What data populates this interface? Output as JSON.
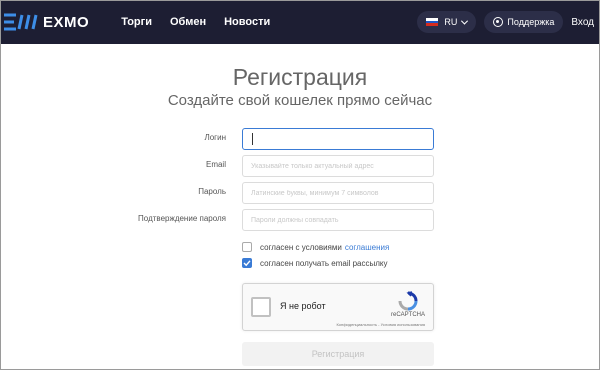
{
  "nav": {
    "brand": "EXMO",
    "menu": [
      "Торги",
      "Обмен",
      "Новости"
    ],
    "language": "RU",
    "support_label": "Поддержка",
    "login_label": "Вход"
  },
  "form": {
    "title": "Регистрация",
    "subtitle": "Создайте свой кошелек прямо сейчас",
    "fields": [
      {
        "label": "Логин",
        "value": "",
        "placeholder": ""
      },
      {
        "label": "Email",
        "value": "",
        "placeholder": "Указывайте только актуальный адрес"
      },
      {
        "label": "Пароль",
        "value": "",
        "placeholder": "Латинские буквы, минимум 7 символов"
      },
      {
        "label": "Подтверждение пароля",
        "value": "",
        "placeholder": "Пароли должны совпадать"
      }
    ],
    "agree_text": "согласен с условиями",
    "agree_link": "соглашения",
    "agree_checked": false,
    "newsletter_text": "согласен получать email рассылку",
    "newsletter_checked": true,
    "submit_label": "Регистрация"
  },
  "captcha": {
    "label": "Я не робот",
    "brand": "reCAPTCHA",
    "links": "Конфиденциальность - Условия использования"
  },
  "colors": {
    "nav_bg": "#1d1e33",
    "accent": "#3a7bd5",
    "logo_blue": "#3d8ee8"
  }
}
